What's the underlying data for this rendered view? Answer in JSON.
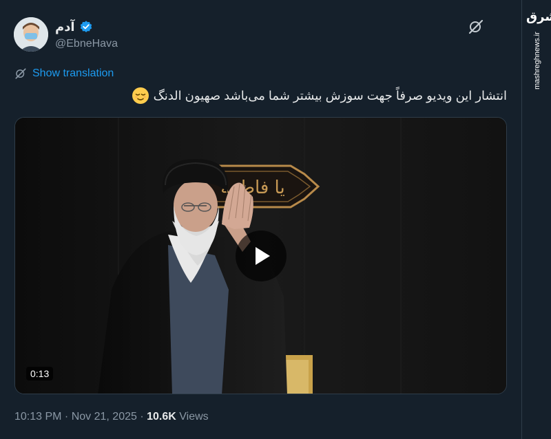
{
  "author": {
    "display_name": "آدم",
    "handle": "@EbneHava",
    "verified": true
  },
  "translate": {
    "label": "Show translation"
  },
  "tweet": {
    "text": "انتشار این ویدیو صرفاً جهت سوزش بیشتر شما می‌باشد صهیون الدنگ",
    "emoji": "relieved-face-emoji"
  },
  "media": {
    "duration": "0:13",
    "banner_text": "یا فاطمة"
  },
  "meta": {
    "time": "10:13 PM",
    "sep1": " · ",
    "date": "Nov 21, 2025",
    "sep2": " · ",
    "views_count": "10.6K",
    "views_label": " Views"
  },
  "watermark": {
    "logo": "مشرق",
    "site": "mashreghnews.ir"
  },
  "colors": {
    "background": "#15202b",
    "accent": "#1d9bf0",
    "muted": "#8b98a5"
  }
}
